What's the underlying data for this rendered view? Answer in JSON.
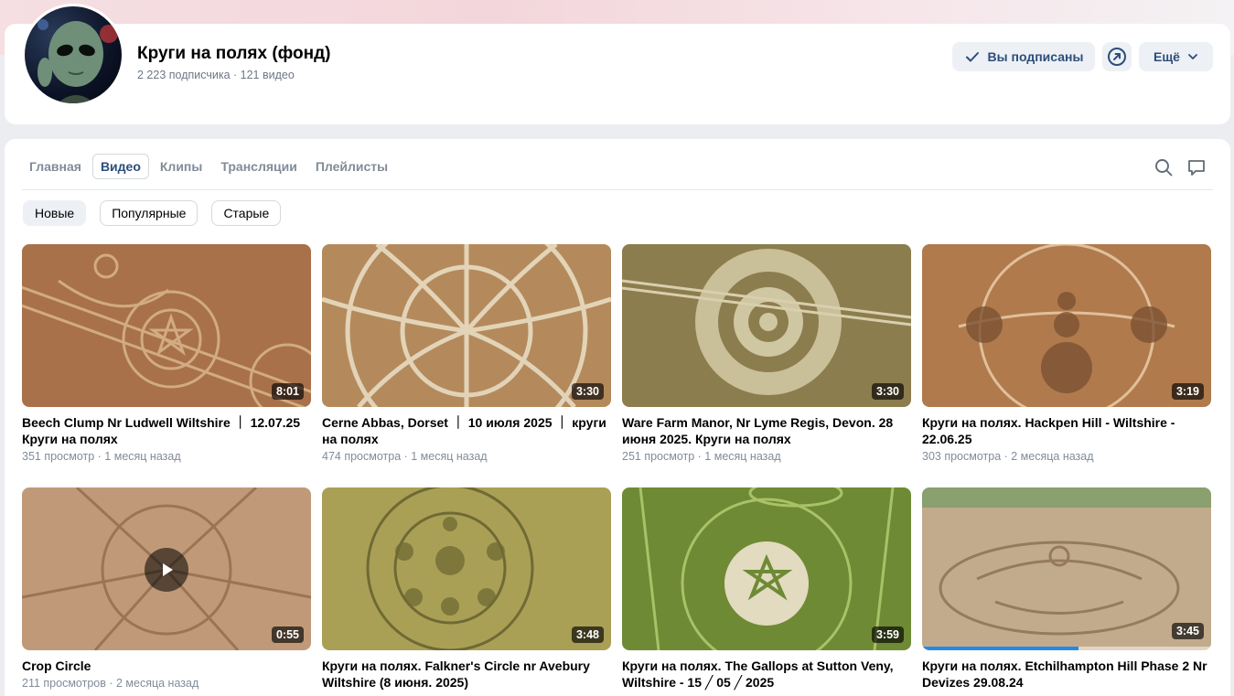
{
  "channel": {
    "title": "Круги на полях (фонд)",
    "meta": "2 223 подписчика · 121 видео",
    "subscribed_label": "Вы подписаны",
    "more_label": "Ещё"
  },
  "tabs": [
    {
      "label": "Главная",
      "active": false
    },
    {
      "label": "Видео",
      "active": true
    },
    {
      "label": "Клипы",
      "active": false
    },
    {
      "label": "Трансляции",
      "active": false
    },
    {
      "label": "Плейлисты",
      "active": false
    }
  ],
  "sort_chips": [
    {
      "label": "Новые",
      "active": true
    },
    {
      "label": "Популярные",
      "active": false
    },
    {
      "label": "Старые",
      "active": false
    }
  ],
  "videos": [
    {
      "title": "Beech Clump Nr Ludwell Wiltshire ｜ 12.07.25 Круги на полях",
      "meta": "351 просмотр · 1 месяц назад",
      "duration": "8:01",
      "palette": "#a8714a"
    },
    {
      "title": "Cerne Abbas, Dorset ｜ 10 июля 2025 ｜ круги на полях",
      "meta": "474 просмотра · 1 месяц назад",
      "duration": "3:30",
      "palette": "#b48a5c"
    },
    {
      "title": "Ware Farm Manor, Nr Lyme Regis, Devon. 28 июня 2025. Круги на полях",
      "meta": "251 просмотр · 1 месяц назад",
      "duration": "3:30",
      "palette": "#8c7d4e"
    },
    {
      "title": "Круги на полях. Hackpen Hill - Wiltshire - 22.06.25",
      "meta": "303 просмотра · 2 месяца назад",
      "duration": "3:19",
      "palette": "#b07a4c"
    },
    {
      "title": "Crop Circle",
      "meta": "211 просмотров · 2 месяца назад",
      "duration": "0:55",
      "palette": "#c09a78",
      "playing": true
    },
    {
      "title": "Круги на полях. Falkner's Circle nr Avebury Wiltshire (8 июня. 2025)",
      "meta": "",
      "duration": "3:48",
      "palette": "#a9a056"
    },
    {
      "title": "Круги на полях. The Gallops at Sutton Veny, Wiltshire - 15 ╱ 05 ╱ 2025",
      "meta": "",
      "duration": "3:59",
      "palette": "#6f8a34"
    },
    {
      "title": "Круги на полях. Etchilhampton Hill Phase 2 Nr Devizes 29.08.24",
      "meta": "",
      "duration": "3:45",
      "palette": "#c2ab8c",
      "progress": 0.54
    }
  ]
}
